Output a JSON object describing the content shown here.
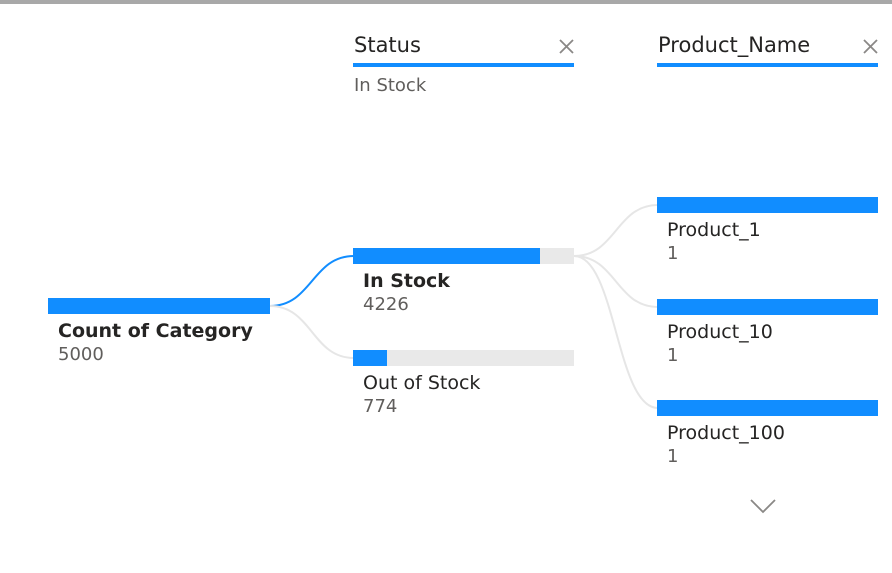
{
  "chart_data": {
    "type": "decomposition_tree",
    "root": {
      "label": "Count of Category",
      "value": "5000"
    },
    "levels": [
      {
        "header": "Status",
        "filter": "In Stock",
        "nodes": [
          {
            "label": "In Stock",
            "value": "4226",
            "fraction": 0.845,
            "selected": true
          },
          {
            "label": "Out of Stock",
            "value": "774",
            "fraction": 0.155,
            "selected": false
          }
        ]
      },
      {
        "header": "Product_Name",
        "nodes": [
          {
            "label": "Product_1",
            "value": "1",
            "fraction": 1.0
          },
          {
            "label": "Product_10",
            "value": "1",
            "fraction": 1.0
          },
          {
            "label": "Product_100",
            "value": "1",
            "fraction": 1.0
          }
        ]
      }
    ]
  },
  "colors": {
    "bar": "#118dff",
    "track": "#e9e9e9",
    "connector_active": "#118dff",
    "connector_inactive": "#e6e6e6",
    "top_border": "#a8a8a8"
  },
  "icons": {
    "close": "close-icon",
    "more": "chevron-down-icon"
  }
}
